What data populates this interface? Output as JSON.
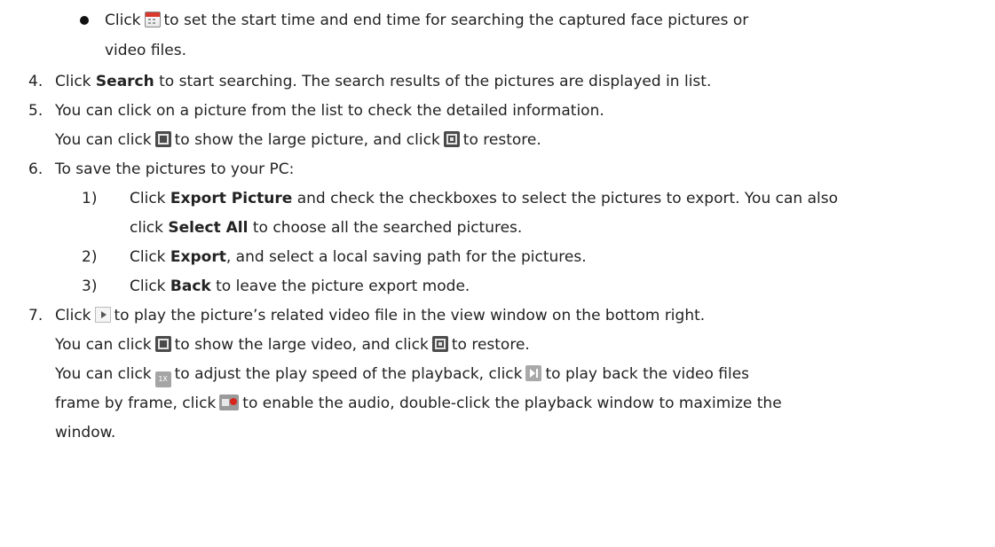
{
  "bullet_item": {
    "l1_a": "Click",
    "l1_b": "to set the start time and end time for searching the captured face pictures or",
    "l2": "video files.",
    "icon": "calendar-icon"
  },
  "steps": {
    "s4": {
      "num": "4.",
      "a": "Click",
      "bold": "Search",
      "b": "to start searching. The search results of the pictures are displayed in list."
    },
    "s5": {
      "num": "5.",
      "l1": "You can click on a picture from the list to check the detailed information.",
      "l2_a": "You can click",
      "l2_b": "to show the large picture, and click",
      "l2_c": "to restore."
    },
    "s6": {
      "num": "6.",
      "l1": "To save the pictures to your PC:"
    },
    "s7": {
      "num": "7.",
      "l1_a": "Click",
      "l1_b": "to play the picture’s related video file in the view window on the bottom right.",
      "l2_a": "You can click",
      "l2_b": "to show the large video, and click",
      "l2_c": "to restore.",
      "l3_a": "You can click",
      "l3_b": "to adjust the play speed of the playback, click",
      "l3_c": "to play back the video files",
      "l4_a": "frame by frame, click",
      "l4_b": "to enable the audio, double-click the playback window to maximize the",
      "l5": "window."
    }
  },
  "substeps": [
    {
      "num": "1)",
      "a": "Click",
      "bold": "Export Picture",
      "b": "and check the checkboxes to select the pictures to export. You can also",
      "c_a": "click",
      "c_bold": "Select All",
      "c_b": "to choose all the searched pictures."
    },
    {
      "num": "2)",
      "a": "Click",
      "bold": "Export",
      "b": ", and select a local saving path for the pictures."
    },
    {
      "num": "3)",
      "a": "Click",
      "bold": "Back",
      "b": "to leave the picture export mode."
    }
  ],
  "icons": {
    "enlarge": "enlarge-icon",
    "restore": "restore-icon",
    "play": "play-icon",
    "speed": "speed-icon",
    "speed_text": "1X",
    "frame": "frame-icon",
    "audio": "audio-icon"
  }
}
